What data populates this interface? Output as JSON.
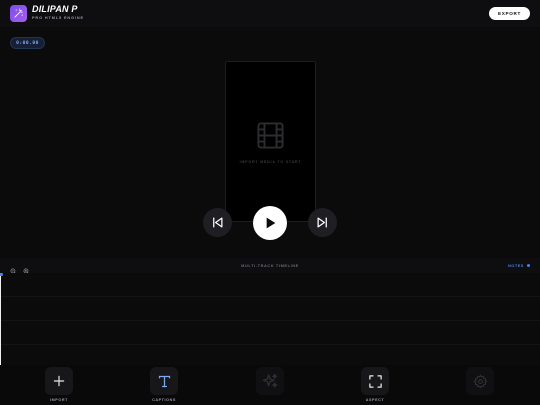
{
  "header": {
    "brand": "DILIPAN P",
    "tagline": "PRO HTML5 ENGINE",
    "export_label": "EXPORT"
  },
  "transport": {
    "timecode": "0:00.00"
  },
  "preview": {
    "hint": "IMPORT MEDIA TO START"
  },
  "timeline": {
    "title": "MULTI-TRACK TIMELINE",
    "notes_label": "NOTES"
  },
  "toolbar": {
    "items": [
      {
        "label": "IMPORT",
        "icon": "plus-icon",
        "enabled": true
      },
      {
        "label": "CAPTIONS",
        "icon": "text-icon",
        "enabled": true
      },
      {
        "label": "",
        "icon": "sparkles-icon",
        "enabled": false
      },
      {
        "label": "ASPECT",
        "icon": "expand-icon",
        "enabled": true
      },
      {
        "label": "",
        "icon": "gear-icon",
        "enabled": false
      }
    ]
  },
  "colors": {
    "accent": "#4f7fe0",
    "brand_gradient_start": "#7b4ff0",
    "brand_gradient_end": "#a35ee8",
    "background": "#0b0b0c"
  }
}
